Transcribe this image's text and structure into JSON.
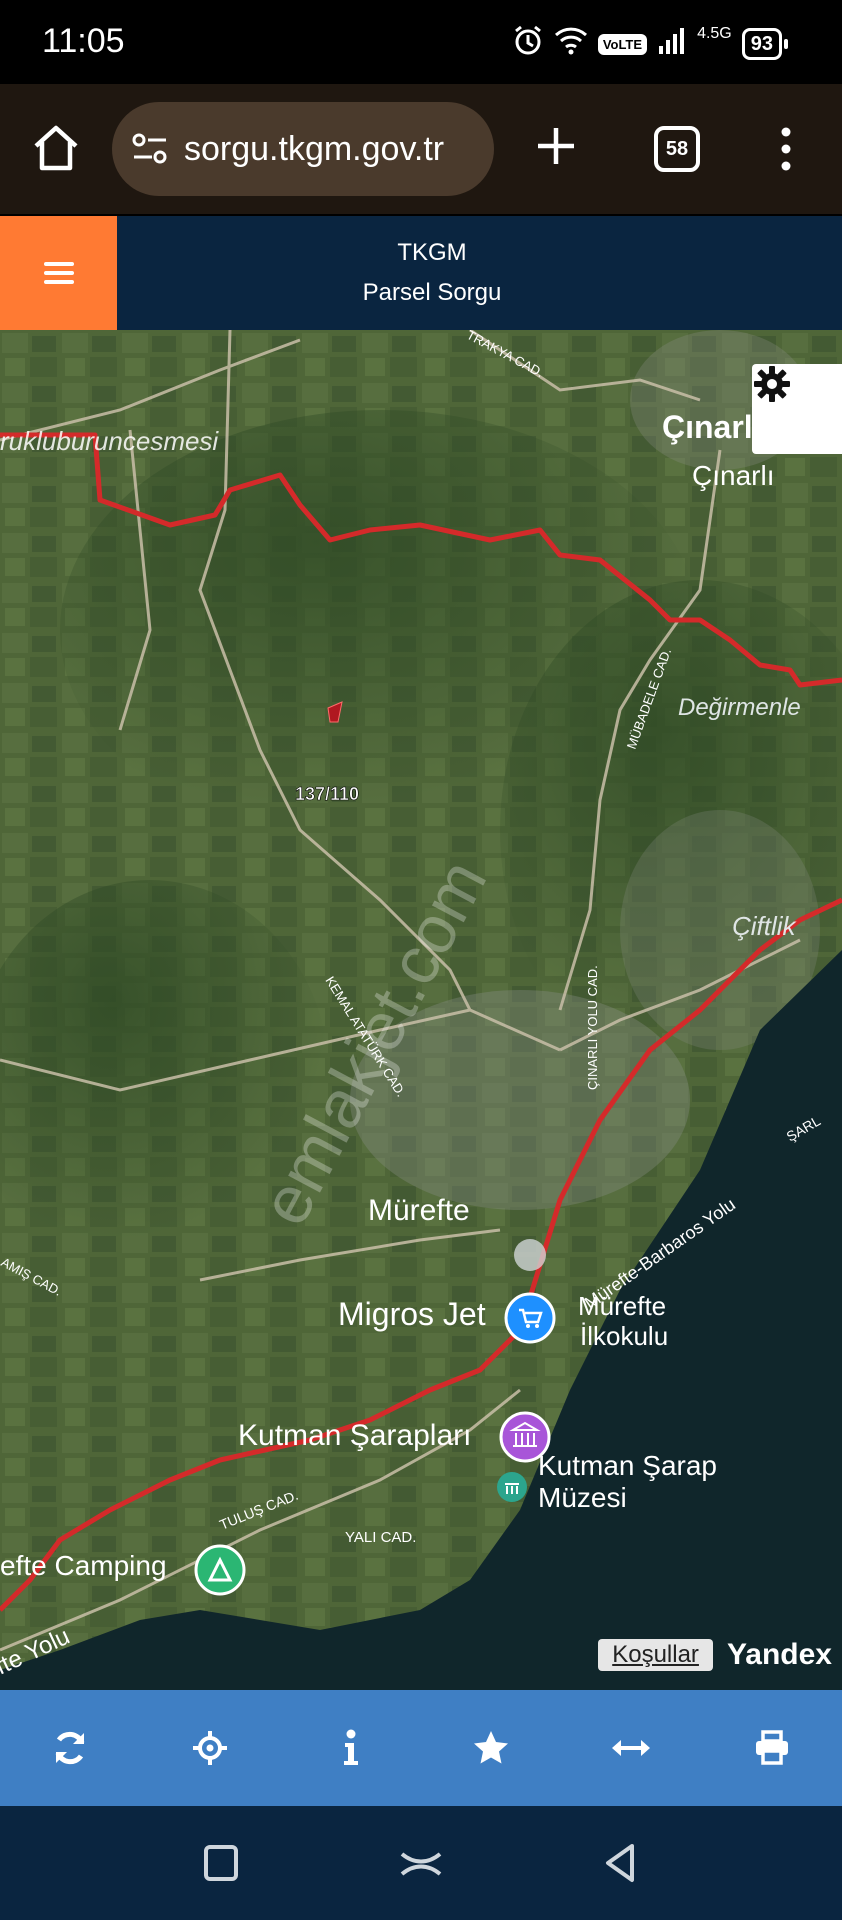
{
  "status_bar": {
    "time": "11:05",
    "volte": "VoLTE",
    "network": "4.5G",
    "battery": "93"
  },
  "browser": {
    "url": "sorgu.tkgm.gov.tr",
    "tab_count": "58"
  },
  "header": {
    "org": "TKGM",
    "title": "Parsel Sorgu"
  },
  "map": {
    "labels": {
      "burunkucesmesi": "rukluburuncesmesi",
      "trakya": "TRAKYA CAD.",
      "cinarli_top": "Çınarl",
      "cinarli": "Çınarlı",
      "degirmenler": "Değirmenle",
      "mubadele": "MÜBADELE CAD.",
      "parcel": "137/110",
      "ciftlik": "Çiftlik",
      "cinarli_yolu": "ÇINARLI YOLU CAD.",
      "kemal_ataturk": "KEMAL ATATÜRK CAD.",
      "murefte": "Mürefte",
      "mis_cad": "AMIŞ CAD.",
      "migros": "Migros Jet",
      "ilkokulu_1": "Mürefte",
      "ilkokulu_2": "İlkokulu",
      "barbaros": "Mürefte-Barbaros Yolu",
      "kutman": "Kutman Şarapları",
      "kutman_muze_1": "Kutman Şarap",
      "kutman_muze_2": "Müzesi",
      "tulus": "TULUŞ CAD.",
      "yali": "YALI CAD.",
      "camping": "efte Camping",
      "sarkoy_yolu": "fte Yolu",
      "sarkoy_top": "ŞARL",
      "watermark": "emlakjet.com"
    },
    "attribution": {
      "terms": "Koşullar",
      "provider": "Yandex"
    },
    "colors": {
      "boundary": "#d42a2a",
      "land": "#4a6136",
      "sea": "#0f2428"
    }
  },
  "toolbar": {
    "items": [
      "refresh-icon",
      "locate-icon",
      "info-icon",
      "star-icon",
      "measure-icon",
      "print-icon"
    ]
  },
  "icons": {
    "home": "home-icon",
    "site_settings": "site-settings-icon",
    "new_tab": "plus-icon",
    "menu": "more-vert-icon",
    "hamburger": "hamburger-icon",
    "gear": "gear-icon"
  }
}
